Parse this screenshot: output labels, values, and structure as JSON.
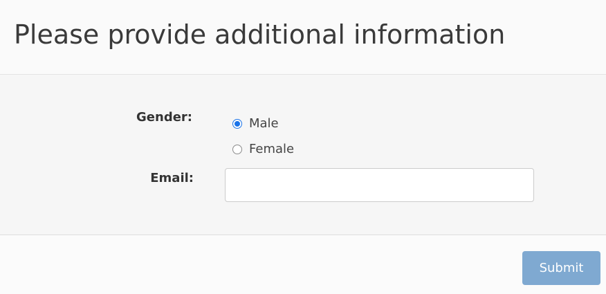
{
  "dialog": {
    "title": "Please provide additional information"
  },
  "form": {
    "gender": {
      "label": "Gender:",
      "options": [
        {
          "label": "Male",
          "selected": true
        },
        {
          "label": "Female",
          "selected": false
        }
      ]
    },
    "email": {
      "label": "Email:",
      "value": "",
      "placeholder": ""
    }
  },
  "footer": {
    "submit_label": "Submit"
  },
  "colors": {
    "radio_selected": "#1a73e8",
    "submit_button": "#7fa9d1"
  }
}
